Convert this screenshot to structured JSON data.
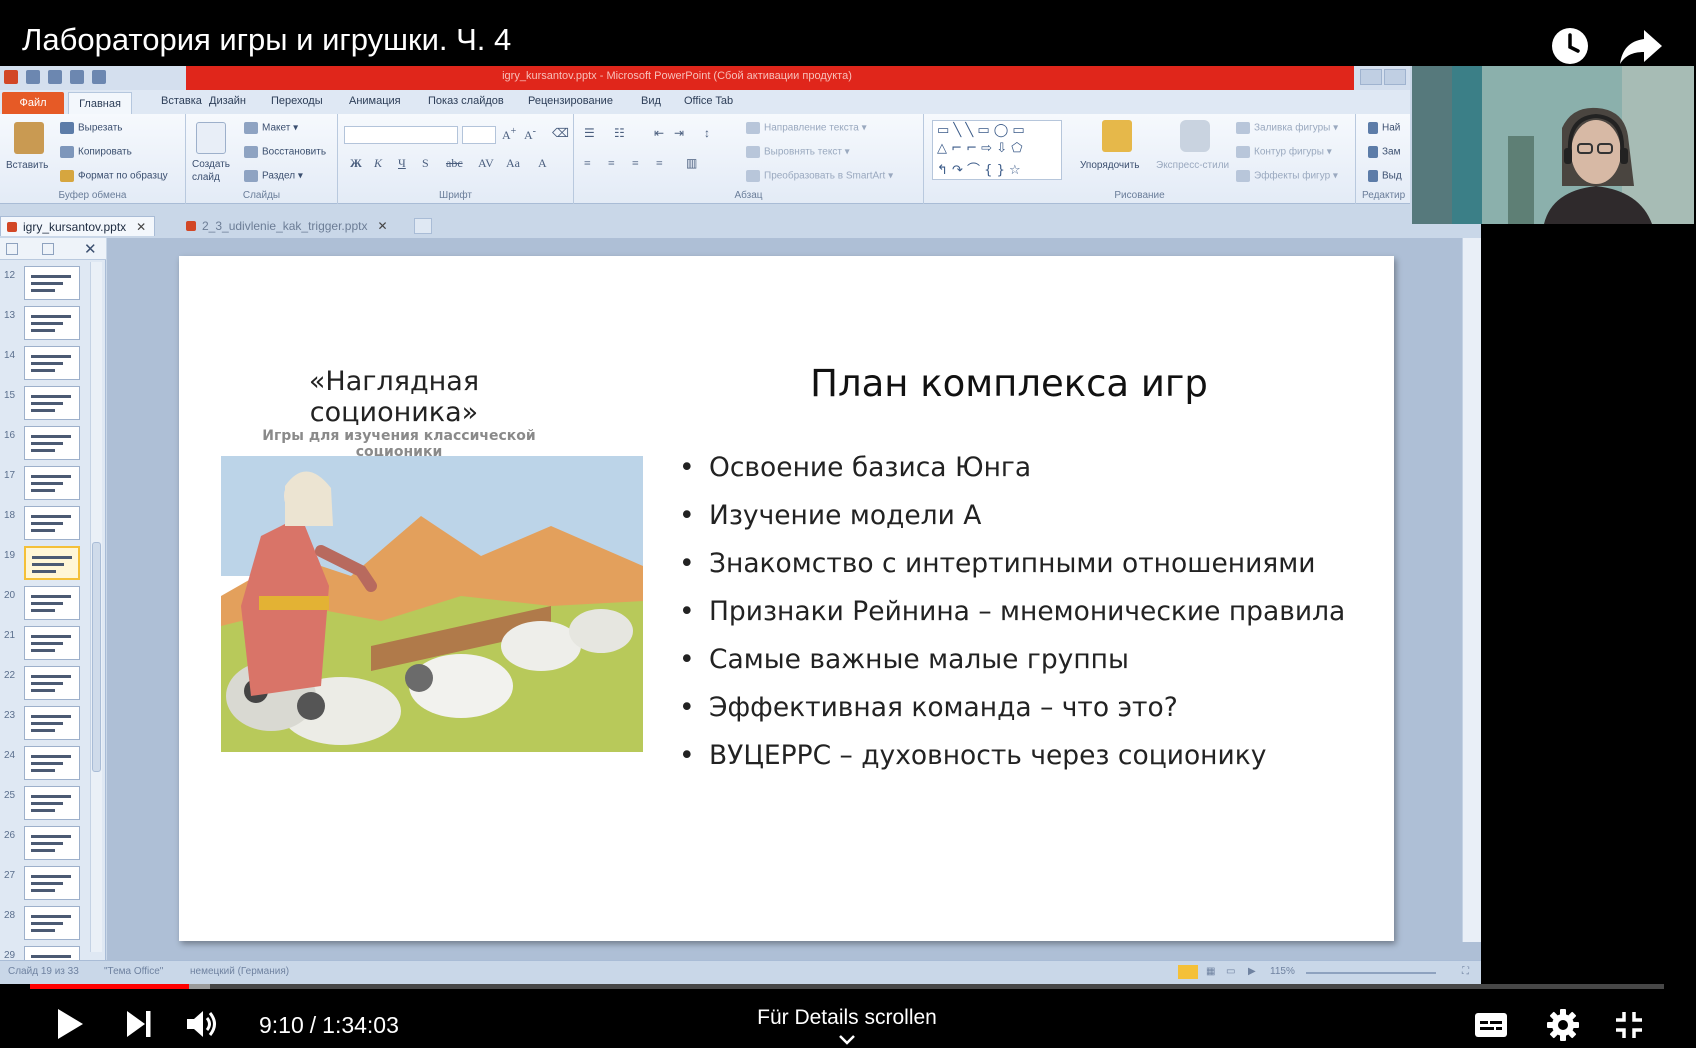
{
  "video": {
    "title": "Лаборатория игры и игрушки. Ч. 4",
    "current_time": "9:10",
    "duration": "1:34:03",
    "progress_fraction": 0.0975,
    "buffered_fraction": 0.11,
    "scroll_hint": "Für Details scrollen"
  },
  "powerpoint": {
    "window_caption": "igry_kursantov.pptx - Microsoft PowerPoint (Сбой активации продукта)",
    "ribbon_tabs": [
      "Файл",
      "Главная",
      "Вставка",
      "Дизайн",
      "Переходы",
      "Анимация",
      "Показ слайдов",
      "Рецензирование",
      "Вид",
      "Office Tab"
    ],
    "clipboard": {
      "paste": "Вставить",
      "cut": "Вырезать",
      "copy": "Копировать",
      "format_painter": "Формат по образцу",
      "group": "Буфер обмена"
    },
    "slides_group": {
      "new_slide": "Создать слайд",
      "layout": "Макет",
      "reset": "Восстановить",
      "section": "Раздел",
      "group": "Слайды"
    },
    "font_group": "Шрифт",
    "paragraph_group": {
      "text_direction": "Направление текста",
      "align_text": "Выровнять текст",
      "smartart": "Преобразовать в SmartArt",
      "group": "Абзац"
    },
    "drawing_group": {
      "arrange": "Упорядочить",
      "quick_styles": "Экспресс-стили",
      "shape_fill": "Заливка фигуры",
      "shape_outline": "Контур фигуры",
      "shape_effects": "Эффекты фигур",
      "group": "Рисование"
    },
    "editing_group": {
      "find": "Най",
      "replace": "Зам",
      "select": "Выд",
      "group": "Редактир"
    },
    "doc_tabs": [
      {
        "name": "igry_kursantov.pptx",
        "active": true
      },
      {
        "name": "2_3_udivlenie_kak_trigger.pptx",
        "active": false
      }
    ],
    "thumbnails": [
      "12",
      "13",
      "14",
      "15",
      "16",
      "17",
      "18",
      "19",
      "20",
      "21",
      "22",
      "23",
      "24",
      "25",
      "26",
      "27",
      "28",
      "29"
    ],
    "selected_slide": "19",
    "status": {
      "slide": "Слайд 19 из 33",
      "theme": "\"Тема Office\"",
      "language": "немецкий (Германия)",
      "zoom": "115%"
    }
  },
  "slide": {
    "left_title": "«Наглядная соционика»",
    "left_subtitle": "Игры для изучения классической соционики",
    "right_title": "План комплекса игр",
    "bullets": [
      "Освоение базиса Юнга",
      "Изучение модели А",
      "Знакомство с интертипными отношениями",
      "Признаки Рейнина – мнемонические правила",
      "Самые важные малые группы",
      "Эффективная команда – что это?",
      "ВУЦЕРРС – духовность через соционику"
    ]
  },
  "colors": {
    "progress_played": "#ff0000",
    "ppt_file_tab": "#e65a26",
    "ppt_titlebar_alert": "#e0261b",
    "selected_thumbnail_border": "#f4c038"
  },
  "icons": [
    "watch-later-icon",
    "share-icon",
    "play-icon",
    "next-icon",
    "volume-icon",
    "subtitles-icon",
    "settings-gear-icon",
    "exit-fullscreen-icon",
    "chevron-down-icon"
  ]
}
